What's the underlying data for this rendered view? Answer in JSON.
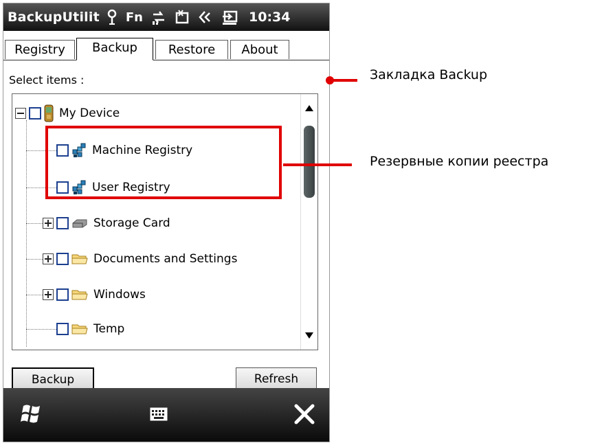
{
  "status_bar": {
    "title": "BackupUtilit",
    "fn_label": "Fn",
    "time": "10:34",
    "icons": [
      "signal-antenna-icon",
      "connectivity-arrows-icon",
      "battery-icon",
      "volume-icon",
      "usb-sync-icon"
    ]
  },
  "tabs": [
    {
      "label": "Registry",
      "active": false
    },
    {
      "label": "Backup",
      "active": true
    },
    {
      "label": "Restore",
      "active": false
    },
    {
      "label": "About",
      "active": false
    }
  ],
  "select_label": "Select items :",
  "tree": [
    {
      "label": "My Device",
      "expander": "minus",
      "icon": "device-icon",
      "level": 0
    },
    {
      "label": "Machine Registry",
      "expander": null,
      "icon": "registry-icon",
      "level": 1
    },
    {
      "label": "User Registry",
      "expander": null,
      "icon": "registry-icon",
      "level": 1
    },
    {
      "label": "Storage Card",
      "expander": "plus",
      "icon": "storage-card-icon",
      "level": 1
    },
    {
      "label": "Documents and Settings",
      "expander": "plus",
      "icon": "folder-icon",
      "level": 1
    },
    {
      "label": "Windows",
      "expander": "plus",
      "icon": "folder-icon",
      "level": 1
    },
    {
      "label": "Temp",
      "expander": null,
      "icon": "folder-icon",
      "level": 1
    }
  ],
  "buttons": {
    "backup": "Backup",
    "refresh": "Refresh"
  },
  "annotations": {
    "backup_tab": "Закладка Backup",
    "registry_copies": "Резервные копии реестра"
  },
  "colors": {
    "annotation": "#e00000",
    "checkbox_border": "#1b3f8f"
  }
}
